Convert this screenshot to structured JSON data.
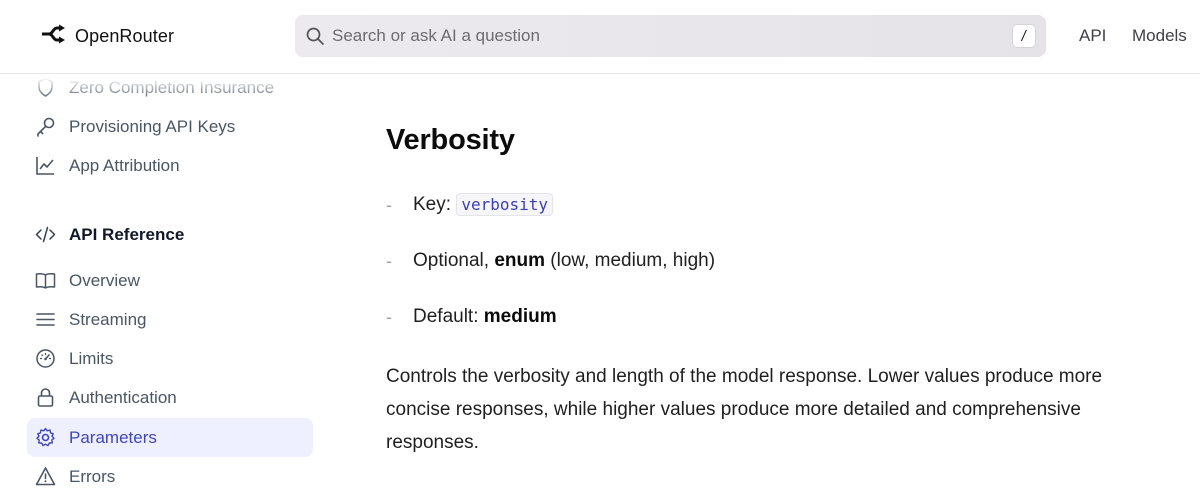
{
  "header": {
    "brand": "OpenRouter",
    "search_placeholder": "Search or ask AI a question",
    "search_shortcut": "/",
    "nav": [
      "API",
      "Models"
    ]
  },
  "sidebar": {
    "items_top": [
      {
        "label": "Zero Completion Insurance",
        "icon": "shield-icon"
      },
      {
        "label": "Provisioning API Keys",
        "icon": "key-icon"
      },
      {
        "label": "App Attribution",
        "icon": "chart-line-icon"
      }
    ],
    "section": {
      "label": "API Reference",
      "icon": "code-icon"
    },
    "items": [
      {
        "label": "Overview",
        "icon": "book-icon"
      },
      {
        "label": "Streaming",
        "icon": "lines-icon"
      },
      {
        "label": "Limits",
        "icon": "gauge-icon"
      },
      {
        "label": "Authentication",
        "icon": "lock-icon"
      },
      {
        "label": "Parameters",
        "icon": "gear-icon",
        "active": true
      },
      {
        "label": "Errors",
        "icon": "warning-icon"
      }
    ]
  },
  "main": {
    "heading": "Verbosity",
    "key_label": "Key:",
    "key_code": "verbosity",
    "optional_prefix": "Optional,",
    "optional_type": "enum",
    "optional_values": "(low, medium, high)",
    "default_label": "Default:",
    "default_value": "medium",
    "description": "Controls the verbosity and length of the model response. Lower values produce more concise responses, while higher values produce more detailed and comprehensive responses."
  },
  "colors": {
    "accent": "#4046b8",
    "active_bg": "#eef0ff"
  }
}
